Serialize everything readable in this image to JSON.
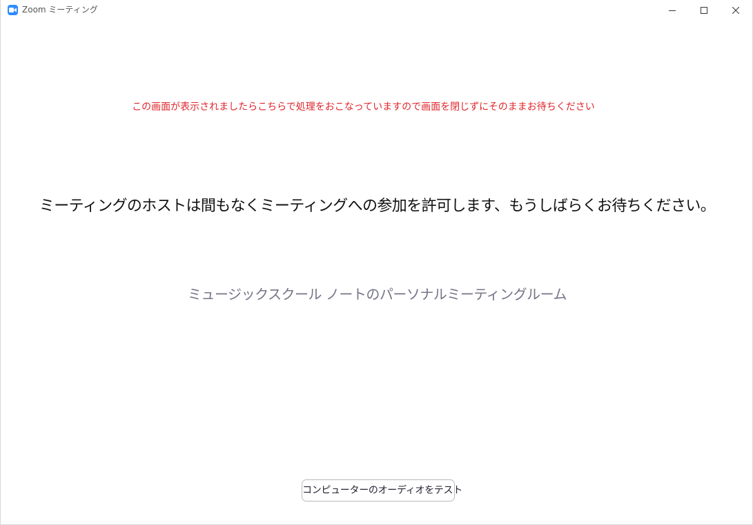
{
  "window": {
    "title": "Zoom ミーティング",
    "app_icon": "zoom-camera-icon",
    "controls": {
      "minimize_icon": "minimize-icon",
      "maximize_icon": "maximize-icon",
      "close_icon": "close-icon"
    }
  },
  "main": {
    "notice": "この画面が表示されましたらこちらで処理をおこなっていますので画面を閉じずにそのままお待ちください",
    "waiting_message": "ミーティングのホストは間もなくミーティングへの参加を許可します、もうしばらくお待ちください。",
    "room_name": "ミュージックスクール ノートのパーソナルミーティングルーム",
    "test_audio_button": "コンピューターのオーディオをテスト"
  },
  "colors": {
    "notice_red": "#e0252b",
    "room_name_gray": "#747487",
    "zoom_blue": "#2d8cff",
    "button_border": "#b9b9bd"
  }
}
